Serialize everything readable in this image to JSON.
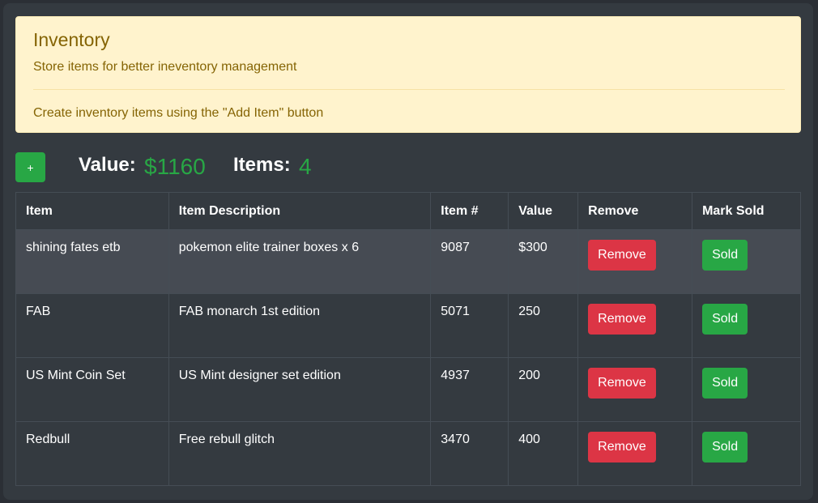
{
  "alert": {
    "title": "Inventory",
    "subtitle": "Store items for better ineventory management",
    "hint": "Create inventory items using the \"Add Item\" button"
  },
  "toolbar": {
    "add_label": "+",
    "value_label": "Value:",
    "value_amount": "$1160",
    "items_label": "Items:",
    "items_count": "4"
  },
  "table": {
    "headers": [
      "Item",
      "Item Description",
      "Item #",
      "Value",
      "Remove",
      "Mark Sold"
    ],
    "remove_label": "Remove",
    "sold_label": "Sold",
    "rows": [
      {
        "item": "shining fates etb",
        "description": "pokemon elite trainer boxes x 6",
        "number": "9087",
        "value": "$300"
      },
      {
        "item": "FAB",
        "description": "FAB monarch 1st edition",
        "number": "5071",
        "value": "250"
      },
      {
        "item": "US Mint Coin Set",
        "description": "US Mint designer set edition",
        "number": "4937",
        "value": "200"
      },
      {
        "item": "Redbull",
        "description": "Free rebull glitch",
        "number": "3470",
        "value": "400"
      }
    ]
  },
  "colors": {
    "accent_green": "#28a745",
    "danger_red": "#dc3545",
    "alert_bg": "#fff3cd",
    "background": "#343a40"
  }
}
